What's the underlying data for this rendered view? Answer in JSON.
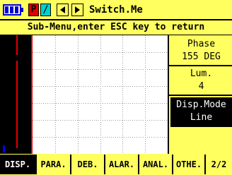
{
  "topbar": {
    "p_label": "P",
    "slash_label": "/",
    "title": "Switch.Me"
  },
  "subbar": {
    "text": "Sub-Menu,enter ESC key to return"
  },
  "panel": {
    "phase_label": "Phase",
    "phase_value": "155 DEG",
    "lum_label": "Lum.",
    "lum_value": "4",
    "disp_label": "Disp.Mode",
    "disp_value": "Line"
  },
  "menu": {
    "items": [
      "DISP.",
      "PARA.",
      "DEB.",
      "ALAR.",
      "ANAL.",
      "OTHE."
    ],
    "page": "2/2"
  },
  "colors": {
    "accent": "#ffff60",
    "alert": "#e00000",
    "cyan": "#00d0d0",
    "battery": "#0000d0"
  }
}
